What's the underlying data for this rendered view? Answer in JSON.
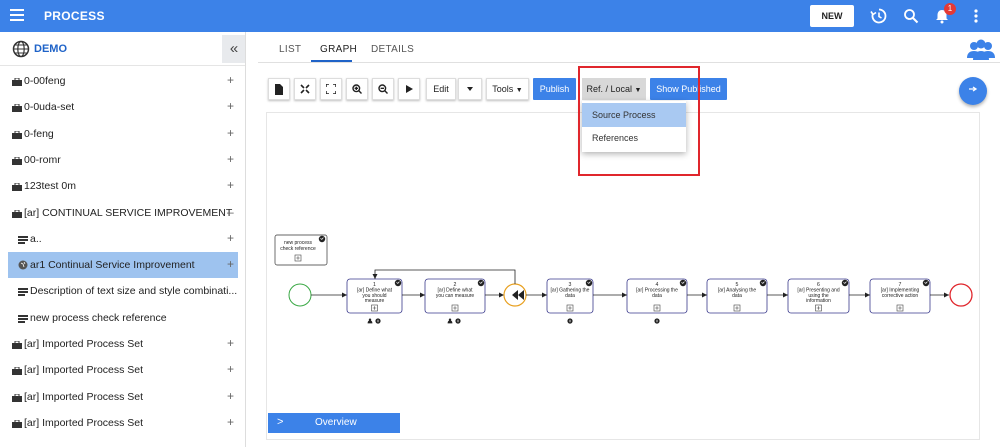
{
  "topbar": {
    "app_title": "PROCESS",
    "new_label": "NEW",
    "notification_count": "1"
  },
  "sidebar": {
    "workspace": "DEMO",
    "collapse_glyph": "«",
    "items": [
      {
        "label": "0-00feng",
        "action": "+",
        "icon": "briefcase-icon"
      },
      {
        "label": "0-0uda-set",
        "action": "+",
        "icon": "briefcase-icon"
      },
      {
        "label": "0-feng",
        "action": "+",
        "icon": "briefcase-icon"
      },
      {
        "label": "00-romr",
        "action": "+",
        "icon": "briefcase-icon"
      },
      {
        "label": "123test 0m",
        "action": "+",
        "icon": "briefcase-icon"
      },
      {
        "label": "[ar] CONTINUAL SERVICE IMPROVEMENT",
        "action": "–",
        "icon": "briefcase-icon"
      },
      {
        "label": "a..",
        "action": "+",
        "icon": "list-icon"
      },
      {
        "label": "ar1 Continual Service Improvement",
        "action": "+",
        "icon": "globe-icon",
        "selected": true
      },
      {
        "label": "Description of text size and style combinati...",
        "action": "",
        "icon": "list-icon"
      },
      {
        "label": "new process check reference",
        "action": "",
        "icon": "list-icon"
      },
      {
        "label": "[ar] Imported Process Set",
        "action": "+",
        "icon": "briefcase-icon"
      },
      {
        "label": "[ar] Imported Process Set",
        "action": "+",
        "icon": "briefcase-icon"
      },
      {
        "label": "[ar] Imported Process Set",
        "action": "+",
        "icon": "briefcase-icon"
      },
      {
        "label": "[ar] Imported Process Set",
        "action": "+",
        "icon": "briefcase-icon"
      }
    ]
  },
  "tabs": [
    {
      "label": "LIST"
    },
    {
      "label": "GRAPH",
      "active": true
    },
    {
      "label": "DETAILS"
    }
  ],
  "toolbar": {
    "edit_label": "Edit",
    "tools_label": "Tools",
    "publish_label": "Publish",
    "ref_local_label": "Ref. / Local",
    "show_published_label": "Show Published"
  },
  "ref_dropdown": {
    "items": [
      "Source Process",
      "References"
    ]
  },
  "diagram": {
    "annotation": [
      "new process",
      "check reference"
    ],
    "tasks": [
      {
        "num": "1",
        "lines": [
          "[ar] Define what",
          "you should",
          "measure"
        ]
      },
      {
        "num": "2",
        "lines": [
          "[ar] Define what",
          "you can measure"
        ]
      },
      {
        "num": "3",
        "lines": [
          "[ar] Gathering the",
          "data"
        ]
      },
      {
        "num": "4",
        "lines": [
          "[ar] Processing the",
          "data"
        ]
      },
      {
        "num": "5",
        "lines": [
          "[ar] Analysing the",
          "data"
        ]
      },
      {
        "num": "6",
        "lines": [
          "[ar] Presenting and",
          "using the",
          "information"
        ]
      },
      {
        "num": "7",
        "lines": [
          "[ar] Implementing",
          "corrective action"
        ]
      }
    ]
  },
  "overview_label": "Overview",
  "colors": {
    "primary": "#3c82e8",
    "selected": "#9ec3ef",
    "highlight_box": "#e0262c",
    "start_event": "#3aa845",
    "end_event": "#e0262c",
    "gateway": "#e8a020"
  }
}
